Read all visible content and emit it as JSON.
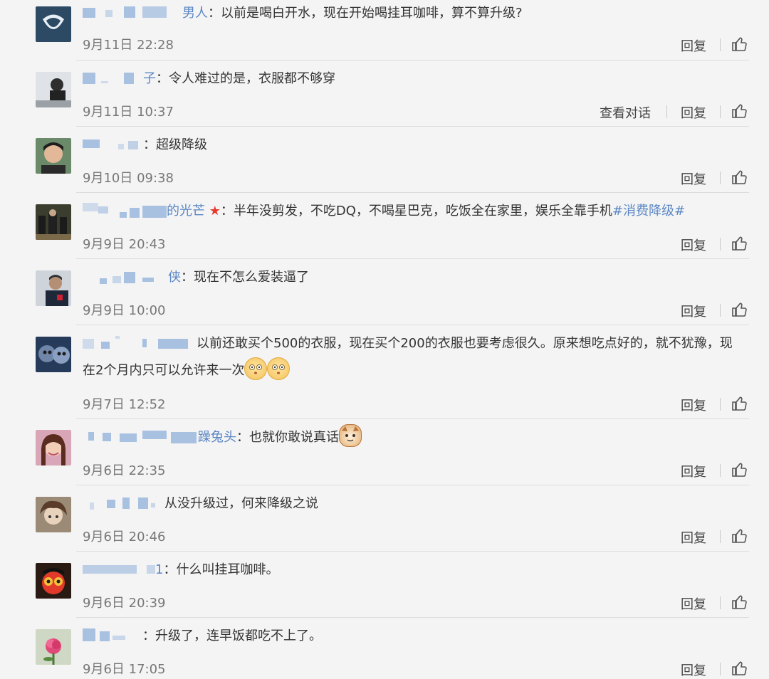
{
  "comments": [
    {
      "name_visible": "男人",
      "colon": "：",
      "text": "以前是喝白开水，现在开始喝挂耳咖啡，算不算升级?",
      "time": "9月11日 22:28",
      "reply": "回复"
    },
    {
      "name_visible": "子",
      "colon": "：",
      "text": "令人难过的是，衣服都不够穿",
      "time": "9月11日 10:37",
      "reply": "回复",
      "dialog": "查看对话"
    },
    {
      "name_visible": "",
      "colon": "：",
      "text": "超级降级",
      "time": "9月10日 09:38",
      "reply": "回复"
    },
    {
      "name_visible": "的光芒",
      "colon": "：",
      "text": "半年没剪发，不吃DQ，不喝星巴克，吃饭全在家里，娱乐全靠手机",
      "tag": "#消费降级#",
      "time": "9月9日 20:43",
      "reply": "回复"
    },
    {
      "name_visible": "侠",
      "colon": "：",
      "text": "现在不怎么爱装逼了",
      "time": "9月9日 10:00",
      "reply": "回复"
    },
    {
      "name_visible": "",
      "colon": "",
      "text": "以前还敢买个500的衣服，现在买个200的衣服也要考虑很久。原来想吃点好的，就不犹豫，现在2个月内只可以允许来一次",
      "time": "9月7日 12:52",
      "reply": "回复"
    },
    {
      "name_visible": "躁兔头",
      "colon": "：",
      "text": "也就你敢说真话",
      "time": "9月6日 22:35",
      "reply": "回复"
    },
    {
      "name_visible": "",
      "colon": "",
      "text": "从没升级过，何来降级之说",
      "time": "9月6日 20:46",
      "reply": "回复"
    },
    {
      "name_visible": "1",
      "colon": "：",
      "text": "什么叫挂耳咖啡。",
      "time": "9月6日 20:39",
      "reply": "回复"
    },
    {
      "name_visible": "",
      "colon": "：",
      "text": "升级了，连早饭都吃不上了。",
      "time": "9月6日 17:05",
      "reply": "回复"
    }
  ],
  "icons": {
    "like": "thumbs-up-icon",
    "vip": "star-icon",
    "emoji": "face-emoji-icon"
  },
  "colors": {
    "link": "#5a86c4",
    "star": "#e63a2e",
    "background": "#f4f4f5"
  }
}
